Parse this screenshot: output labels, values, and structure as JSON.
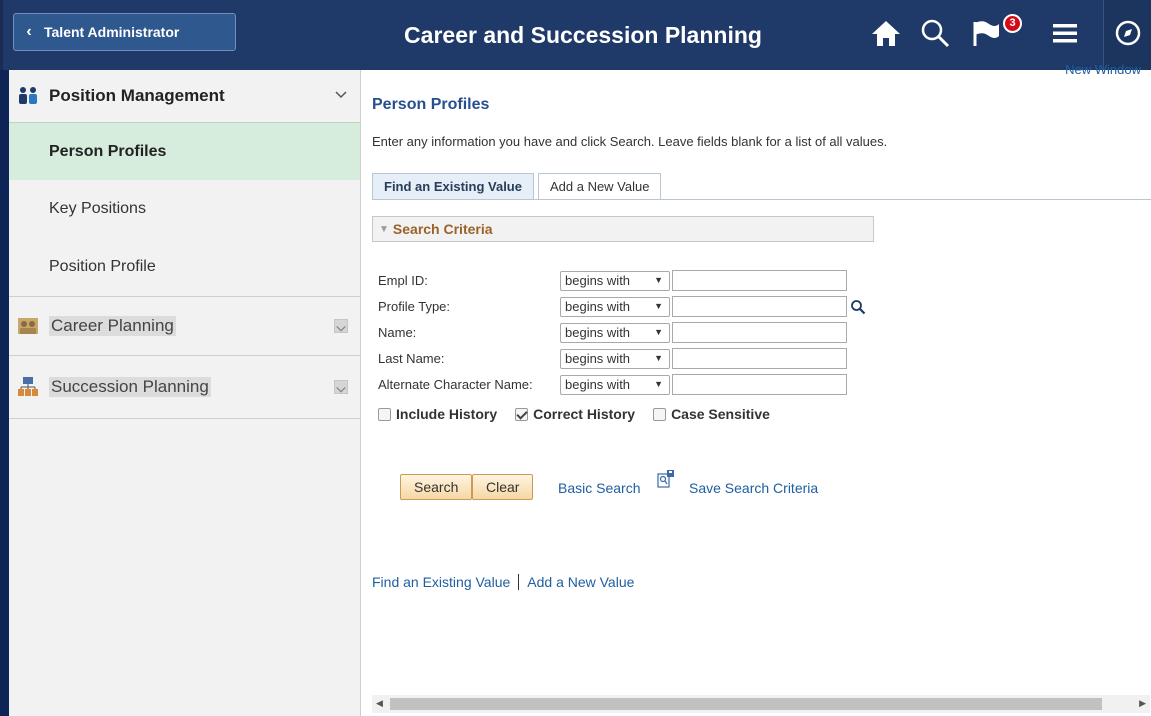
{
  "header": {
    "back_label": "Talent Administrator",
    "title": "Career and Succession Planning",
    "notification_count": "3"
  },
  "sidebar": {
    "groups": [
      {
        "label": "Position Management",
        "icon": "people-icon",
        "items": [
          "Person Profiles",
          "Key Positions",
          "Position Profile"
        ]
      },
      {
        "label": "Career Planning",
        "icon": "career-planning-icon"
      },
      {
        "label": "Succession Planning",
        "icon": "succession-planning-icon"
      }
    ],
    "selected_item": "Person Profiles"
  },
  "main": {
    "new_window": "New Window",
    "page_title": "Person Profiles",
    "instructions": "Enter any information you have and click Search. Leave fields blank for a list of all values.",
    "tabs": [
      "Find an Existing Value",
      "Add a New Value"
    ],
    "search_criteria_title": "Search Criteria",
    "fields": [
      {
        "label": "Empl ID:",
        "operator": "begins with",
        "value": ""
      },
      {
        "label": "Profile Type:",
        "operator": "begins with",
        "value": ""
      },
      {
        "label": "Name:",
        "operator": "begins with",
        "value": ""
      },
      {
        "label": "Last Name:",
        "operator": "begins with",
        "value": ""
      },
      {
        "label": "Alternate Character Name:",
        "operator": "begins with",
        "value": ""
      }
    ],
    "checkboxes": [
      {
        "label": "Include History",
        "checked": false
      },
      {
        "label": "Correct History",
        "checked": true
      },
      {
        "label": "Case Sensitive",
        "checked": false
      }
    ],
    "buttons": {
      "search": "Search",
      "clear": "Clear"
    },
    "links": {
      "basic_search": "Basic Search",
      "save_search": "Save Search Criteria",
      "find_existing": "Find an Existing Value",
      "add_new": "Add a New Value"
    }
  },
  "colors": {
    "header_bg": "#1f3a68",
    "selected_nav_bg": "#d6eddd",
    "link": "#1f5fa0",
    "button_border": "#c99b55"
  }
}
